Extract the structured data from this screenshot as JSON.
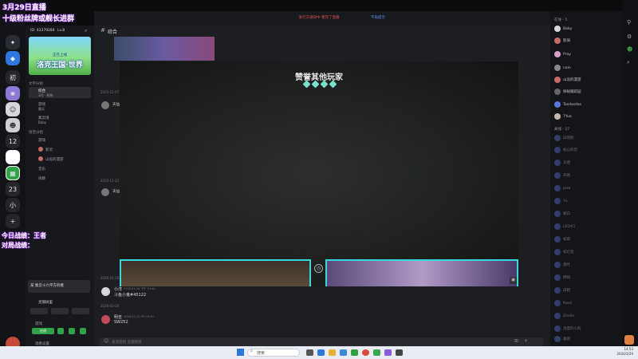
{
  "overlay_text": {
    "line1": "3月29日直播",
    "line2": "十级粉丝牌或舰长进群",
    "game_line1": "今日战绩：王者",
    "game_line2": "对局战绩："
  },
  "server_rail": [
    "初",
    "12",
    "23",
    "小"
  ],
  "sidebar": {
    "server_id": "ID: 43379284",
    "level": "Lv.8",
    "banner_sub": "正在上线",
    "banner_title": "洛克王国·世界",
    "text_group": "文字分组",
    "channels": [
      {
        "name": "综合",
        "meta": "3/1 · 系统"
      },
      {
        "name": "游戏",
        "meta": "聊天"
      },
      {
        "name": "集云境",
        "meta": "Baby"
      }
    ],
    "voice_group": "语音分组",
    "voice_channel": "游戏",
    "voice_users": [
      "新灵",
      "山逗的漫游"
    ],
    "other_channels": [
      "音乐",
      "闲聊"
    ],
    "bottom_hint": "某 集云十六平方的模",
    "bottom_user": "灵丽树里",
    "bottom_online": "在线",
    "bottom_game": "游戏",
    "bottom_footer": "观看设置"
  },
  "main": {
    "channel_title": "综合",
    "notice": "发行方通知中 看完了直播",
    "notice_button": "不再提示",
    "overlay_title": "赞誉其他玩家",
    "messages": [
      {
        "date": "2025-11-07",
        "user": "天仙",
        "time": ""
      },
      {
        "date": "2025-11-12",
        "user": "天仙",
        "time": ""
      },
      {
        "date": "2026-01-10",
        "user": "",
        "time": ""
      },
      {
        "date": "",
        "user": "小洋",
        "time": "2026-01-26 下午 14:40",
        "text": "斗鱼小鬼#45122"
      },
      {
        "date": "2026-03-20",
        "user": "",
        "time": ""
      },
      {
        "date": "",
        "user": "明吉",
        "time": "2026-03-20 PM 19:40",
        "text": "SW252"
      }
    ],
    "input_placeholder": "发消息到 灵丽频道"
  },
  "members": {
    "online_header": "在线 - 5",
    "online": [
      "Baby",
      "影骑",
      "Pray",
      "nain",
      "山逗的漫游",
      "探秘跟踪园",
      "Tasdasdas",
      "7Yue"
    ],
    "offline_header": "离线 - 27",
    "offline": [
      "白鸽鹤",
      "初心的音",
      "天使",
      "开路",
      "pixe",
      "7o",
      "黎白",
      "LEO#1",
      "初雨",
      "初灯星",
      "落叶",
      "佛如",
      "白鹤",
      "Nwol",
      "Zhollo",
      "灵度的小的",
      "桑雨"
    ]
  },
  "taskbar": {
    "search": "搜索",
    "time": "14:53",
    "date": "2026/3/29"
  }
}
